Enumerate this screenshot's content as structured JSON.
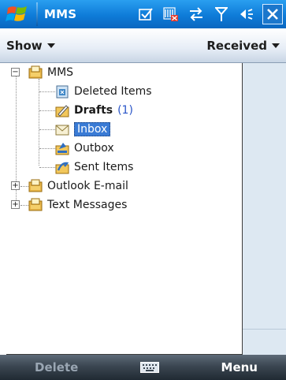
{
  "titlebar": {
    "app_title": "MMS",
    "status_icons": [
      "checklist-icon",
      "signal-off-icon",
      "sync-arrows-icon",
      "antenna-icon",
      "volume-icon"
    ],
    "close_label": "X"
  },
  "toolbar": {
    "show_label": "Show",
    "sort_label": "Received"
  },
  "tree": {
    "root_mms": {
      "label": "MMS",
      "expander": "−"
    },
    "children": [
      {
        "label": "Deleted Items"
      },
      {
        "label": "Drafts",
        "count": "(1)",
        "bold": true
      },
      {
        "label": "Inbox",
        "selected": true
      },
      {
        "label": "Outbox"
      },
      {
        "label": "Sent Items"
      }
    ],
    "outlook": {
      "label": "Outlook E-mail",
      "expander": "+"
    },
    "text_messages": {
      "label": "Text Messages",
      "expander": "+"
    }
  },
  "softbar": {
    "left_label": "Delete",
    "right_label": "Menu"
  },
  "colors": {
    "accent": "#0e7bd8",
    "selection": "#3a7bd5",
    "count": "#2a55c8"
  }
}
